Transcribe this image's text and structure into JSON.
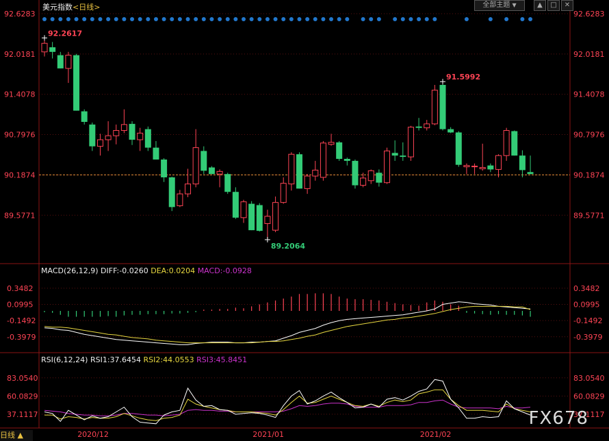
{
  "header": {
    "title": "美元指数",
    "period_label": "<日线>",
    "theme_select": "全部主题",
    "theme_arrow": "▼",
    "ctrl_1": "▲",
    "ctrl_2": "□",
    "ctrl_3": "✕"
  },
  "indicators": {
    "macd_title": "MACD(26,12,9)",
    "macd_diff": "DIFF:-0.0260",
    "macd_dea": "DEA:0.0204",
    "macd_macd": "MACD:-0.0928",
    "rsi_title": "RSI(6,12,24)",
    "rsi1": "RSI1:37.6454",
    "rsi2": "RSI2:44.0553",
    "rsi3": "RSI3:45.8451"
  },
  "footer": {
    "period_tag": "日线 ▲",
    "watermark": "FX678"
  },
  "colors": {
    "up": "#ff4455",
    "down": "#33cc77",
    "diff": "#ffffff",
    "dea": "#e8d840",
    "macd_label": "#cc33cc",
    "rsi1": "#ffffff",
    "rsi2": "#e8d840",
    "rsi3": "#cc33cc",
    "event_dots": "#2277cc",
    "grid": "#5a1010"
  },
  "chart_data": [
    {
      "type": "candlestick",
      "title": "美元指数<日线>",
      "ylim": [
        89.2064,
        92.6283
      ],
      "yticks": [
        "92.6283",
        "92.0181",
        "91.4078",
        "90.7976",
        "90.1874",
        "89.5771"
      ],
      "xticks": [
        "2020/12",
        "2021/01",
        "2021/02"
      ],
      "current_level": 90.1874,
      "annotations": [
        {
          "text": "92.2617",
          "value": 92.2617,
          "index": 0,
          "kind": "high"
        },
        {
          "text": "89.2064",
          "value": 89.2064,
          "index": 28,
          "kind": "low"
        },
        {
          "text": "91.5992",
          "value": 91.5992,
          "index": 50,
          "kind": "high"
        }
      ],
      "candles": [
        {
          "o": 92.05,
          "h": 92.26,
          "l": 91.98,
          "c": 92.18
        },
        {
          "o": 92.12,
          "h": 92.2,
          "l": 91.95,
          "c": 92.05
        },
        {
          "o": 92.0,
          "h": 92.05,
          "l": 91.8,
          "c": 91.8
        },
        {
          "o": 91.8,
          "h": 92.05,
          "l": 91.58,
          "c": 92.0
        },
        {
          "o": 92.0,
          "h": 92.02,
          "l": 91.16,
          "c": 91.16
        },
        {
          "o": 91.15,
          "h": 91.18,
          "l": 90.95,
          "c": 90.99
        },
        {
          "o": 90.95,
          "h": 90.98,
          "l": 90.55,
          "c": 90.62
        },
        {
          "o": 90.62,
          "h": 90.81,
          "l": 90.48,
          "c": 90.72
        },
        {
          "o": 90.72,
          "h": 91.0,
          "l": 90.55,
          "c": 90.78
        },
        {
          "o": 90.78,
          "h": 90.95,
          "l": 90.65,
          "c": 90.86
        },
        {
          "o": 90.86,
          "h": 91.18,
          "l": 90.82,
          "c": 90.95
        },
        {
          "o": 90.96,
          "h": 91.0,
          "l": 90.64,
          "c": 90.72
        },
        {
          "o": 90.72,
          "h": 90.9,
          "l": 90.55,
          "c": 90.82
        },
        {
          "o": 90.88,
          "h": 90.92,
          "l": 90.55,
          "c": 90.6
        },
        {
          "o": 90.6,
          "h": 90.7,
          "l": 90.42,
          "c": 90.42
        },
        {
          "o": 90.42,
          "h": 90.44,
          "l": 90.08,
          "c": 90.15
        },
        {
          "o": 90.15,
          "h": 90.16,
          "l": 89.64,
          "c": 89.7
        },
        {
          "o": 89.72,
          "h": 89.96,
          "l": 89.7,
          "c": 89.9
        },
        {
          "o": 89.9,
          "h": 90.28,
          "l": 89.85,
          "c": 90.05
        },
        {
          "o": 90.05,
          "h": 90.88,
          "l": 90.0,
          "c": 90.6
        },
        {
          "o": 90.55,
          "h": 90.62,
          "l": 90.2,
          "c": 90.25
        },
        {
          "o": 90.3,
          "h": 90.32,
          "l": 90.2,
          "c": 90.2
        },
        {
          "o": 90.2,
          "h": 90.27,
          "l": 90.0,
          "c": 90.24
        },
        {
          "o": 90.2,
          "h": 90.22,
          "l": 89.9,
          "c": 89.93
        },
        {
          "o": 89.93,
          "h": 90.0,
          "l": 89.52,
          "c": 89.54
        },
        {
          "o": 89.54,
          "h": 89.81,
          "l": 89.46,
          "c": 89.78
        },
        {
          "o": 89.75,
          "h": 89.79,
          "l": 89.35,
          "c": 89.35
        },
        {
          "o": 89.73,
          "h": 89.76,
          "l": 89.33,
          "c": 89.34
        },
        {
          "o": 89.45,
          "h": 89.66,
          "l": 89.21,
          "c": 89.56
        },
        {
          "o": 89.35,
          "h": 89.86,
          "l": 89.32,
          "c": 89.77
        },
        {
          "o": 89.77,
          "h": 90.15,
          "l": 89.75,
          "c": 90.06
        },
        {
          "o": 90.05,
          "h": 90.53,
          "l": 89.95,
          "c": 90.5
        },
        {
          "o": 90.5,
          "h": 90.53,
          "l": 89.98,
          "c": 89.98
        },
        {
          "o": 89.98,
          "h": 90.2,
          "l": 89.9,
          "c": 90.17
        },
        {
          "o": 90.17,
          "h": 90.4,
          "l": 90.1,
          "c": 90.26
        },
        {
          "o": 90.15,
          "h": 90.7,
          "l": 90.1,
          "c": 90.67
        },
        {
          "o": 90.65,
          "h": 90.81,
          "l": 90.63,
          "c": 90.68
        },
        {
          "o": 90.68,
          "h": 90.7,
          "l": 90.4,
          "c": 90.43
        },
        {
          "o": 90.43,
          "h": 90.45,
          "l": 90.33,
          "c": 90.4
        },
        {
          "o": 90.4,
          "h": 90.42,
          "l": 89.98,
          "c": 90.03
        },
        {
          "o": 90.03,
          "h": 90.22,
          "l": 90.0,
          "c": 90.14
        },
        {
          "o": 90.1,
          "h": 90.27,
          "l": 90.05,
          "c": 90.25
        },
        {
          "o": 90.22,
          "h": 90.27,
          "l": 90.01,
          "c": 90.07
        },
        {
          "o": 90.07,
          "h": 90.6,
          "l": 90.05,
          "c": 90.55
        },
        {
          "o": 90.52,
          "h": 90.71,
          "l": 90.4,
          "c": 90.48
        },
        {
          "o": 90.48,
          "h": 90.68,
          "l": 90.4,
          "c": 90.46
        },
        {
          "o": 90.46,
          "h": 90.93,
          "l": 90.4,
          "c": 90.91
        },
        {
          "o": 90.92,
          "h": 91.05,
          "l": 90.86,
          "c": 90.9
        },
        {
          "o": 90.9,
          "h": 91.02,
          "l": 90.86,
          "c": 90.96
        },
        {
          "o": 90.96,
          "h": 91.55,
          "l": 90.94,
          "c": 91.47
        },
        {
          "o": 91.55,
          "h": 91.6,
          "l": 90.86,
          "c": 90.88
        },
        {
          "o": 90.88,
          "h": 90.91,
          "l": 90.82,
          "c": 90.83
        },
        {
          "o": 90.83,
          "h": 90.85,
          "l": 90.31,
          "c": 90.34
        },
        {
          "o": 90.31,
          "h": 90.36,
          "l": 90.2,
          "c": 90.33
        },
        {
          "o": 90.31,
          "h": 90.36,
          "l": 90.2,
          "c": 90.32
        },
        {
          "o": 90.28,
          "h": 90.66,
          "l": 90.25,
          "c": 90.3
        },
        {
          "o": 90.33,
          "h": 90.36,
          "l": 90.23,
          "c": 90.27
        },
        {
          "o": 90.27,
          "h": 90.5,
          "l": 90.15,
          "c": 90.48
        },
        {
          "o": 90.48,
          "h": 90.9,
          "l": 90.4,
          "c": 90.86
        },
        {
          "o": 90.85,
          "h": 90.86,
          "l": 90.48,
          "c": 90.48
        },
        {
          "o": 90.48,
          "h": 90.56,
          "l": 90.15,
          "c": 90.26
        },
        {
          "o": 90.23,
          "h": 90.48,
          "l": 90.2,
          "c": 90.2
        }
      ]
    },
    {
      "type": "line",
      "title": "MACD(26,12,9)",
      "ylim": [
        -0.52,
        0.39
      ],
      "yticks": [
        "0.3482",
        "0.0995",
        "-0.1492",
        "-0.3979"
      ],
      "series": [
        {
          "name": "DIFF",
          "values": [
            -0.26,
            -0.27,
            -0.29,
            -0.3,
            -0.33,
            -0.36,
            -0.38,
            -0.4,
            -0.42,
            -0.44,
            -0.45,
            -0.46,
            -0.47,
            -0.48,
            -0.49,
            -0.5,
            -0.51,
            -0.52,
            -0.52,
            -0.5,
            -0.49,
            -0.48,
            -0.48,
            -0.48,
            -0.49,
            -0.49,
            -0.48,
            -0.48,
            -0.47,
            -0.46,
            -0.42,
            -0.38,
            -0.33,
            -0.3,
            -0.27,
            -0.22,
            -0.18,
            -0.15,
            -0.13,
            -0.12,
            -0.11,
            -0.1,
            -0.09,
            -0.08,
            -0.07,
            -0.06,
            -0.04,
            -0.02,
            0.0,
            0.03,
            0.1,
            0.12,
            0.14,
            0.13,
            0.11,
            0.1,
            0.09,
            0.07,
            0.06,
            0.05,
            0.04,
            0.03
          ]
        },
        {
          "name": "DEA",
          "values": [
            -0.24,
            -0.25,
            -0.25,
            -0.26,
            -0.28,
            -0.3,
            -0.32,
            -0.34,
            -0.36,
            -0.37,
            -0.39,
            -0.41,
            -0.42,
            -0.43,
            -0.45,
            -0.46,
            -0.47,
            -0.48,
            -0.49,
            -0.49,
            -0.49,
            -0.49,
            -0.49,
            -0.49,
            -0.49,
            -0.49,
            -0.49,
            -0.48,
            -0.47,
            -0.47,
            -0.46,
            -0.44,
            -0.42,
            -0.39,
            -0.37,
            -0.33,
            -0.3,
            -0.27,
            -0.24,
            -0.22,
            -0.2,
            -0.18,
            -0.16,
            -0.14,
            -0.13,
            -0.11,
            -0.1,
            -0.08,
            -0.06,
            -0.04,
            -0.01,
            0.02,
            0.04,
            0.06,
            0.07,
            0.07,
            0.07,
            0.07,
            0.07,
            0.06,
            0.06,
            0.02
          ]
        },
        {
          "name": "MACD",
          "values": [
            -0.02,
            -0.03,
            -0.06,
            -0.09,
            -0.09,
            -0.09,
            -0.09,
            -0.09,
            -0.08,
            -0.09,
            -0.07,
            -0.06,
            -0.06,
            -0.05,
            -0.05,
            -0.05,
            -0.04,
            -0.04,
            -0.03,
            -0.02,
            0.02,
            0.02,
            0.03,
            0.03,
            0.05,
            0.04,
            0.07,
            0.1,
            0.13,
            0.16,
            0.19,
            0.22,
            0.26,
            0.26,
            0.27,
            0.27,
            0.26,
            0.22,
            0.19,
            0.18,
            0.18,
            0.17,
            0.16,
            0.14,
            0.12,
            0.1,
            0.09,
            0.08,
            0.13,
            0.16,
            0.14,
            0.1,
            0.08,
            -0.03,
            -0.04,
            -0.05,
            -0.06,
            -0.05,
            -0.06,
            -0.06,
            -0.07,
            -0.09
          ]
        }
      ]
    },
    {
      "type": "line",
      "title": "RSI(6,12,24)",
      "ylim": [
        24.0,
        95.0
      ],
      "yticks": [
        "83.0540",
        "60.0829",
        "37.1117"
      ],
      "series": [
        {
          "name": "RSI1",
          "values": [
            40,
            38,
            28,
            42,
            36,
            30,
            35,
            32,
            34,
            40,
            46,
            34,
            27,
            26,
            25,
            36,
            40,
            42,
            70,
            55,
            47,
            48,
            43,
            42,
            37,
            38,
            39,
            38,
            36,
            33,
            48,
            60,
            67,
            50,
            54,
            60,
            65,
            58,
            52,
            45,
            46,
            50,
            46,
            56,
            58,
            55,
            60,
            66,
            69,
            81,
            79,
            56,
            45,
            32,
            32,
            34,
            33,
            34,
            54,
            44,
            40,
            36
          ]
        },
        {
          "name": "RSI2",
          "values": [
            36,
            36,
            31,
            34,
            33,
            31,
            33,
            32,
            32,
            34,
            38,
            35,
            32,
            30,
            29,
            32,
            33,
            36,
            56,
            50,
            47,
            45,
            43,
            42,
            40,
            40,
            40,
            39,
            38,
            36,
            43,
            52,
            60,
            51,
            52,
            56,
            60,
            56,
            52,
            48,
            47,
            50,
            47,
            52,
            55,
            53,
            55,
            63,
            65,
            68,
            68,
            56,
            48,
            42,
            42,
            42,
            41,
            40,
            50,
            44,
            42,
            40
          ]
        },
        {
          "name": "RSI3",
          "values": [
            42,
            41,
            40,
            38,
            37,
            36,
            36,
            35,
            35,
            36,
            38,
            38,
            37,
            36,
            36,
            35,
            36,
            37,
            42,
            43,
            42,
            42,
            41,
            41,
            40,
            40,
            40,
            40,
            40,
            40,
            41,
            44,
            48,
            47,
            48,
            50,
            51,
            51,
            50,
            47,
            46,
            46,
            46,
            48,
            48,
            48,
            49,
            52,
            52,
            54,
            55,
            50,
            46,
            45,
            45,
            45,
            45,
            44,
            47,
            45,
            45,
            46
          ]
        }
      ]
    }
  ]
}
